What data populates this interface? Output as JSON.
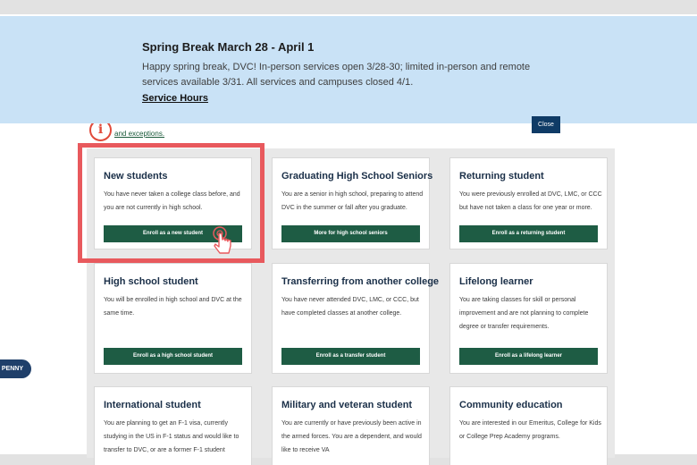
{
  "banner": {
    "title": "Spring Break March 28 - April 1",
    "text": "Happy spring break, DVC! In-person services open 3/28-30; limited in-person and remote services available 3/31. All services and campuses closed 4/1.",
    "link_label": "Service Hours",
    "close_label": "Close"
  },
  "notice": {
    "icon": "info-icon",
    "link_label": "and exceptions."
  },
  "cards": [
    {
      "title": "New students",
      "desc": "You have never taken a college class before, and you are not currently in high school.",
      "button": "Enroll as a new student"
    },
    {
      "title": "Graduating High School Seniors",
      "desc": "You are a senior in high school, preparing to attend DVC in the summer or fall after you graduate.",
      "button": "More for high school seniors"
    },
    {
      "title": "Returning student",
      "desc": "You were previously enrolled at DVC, LMC, or CCC but have not taken a class for one year or more.",
      "button": "Enroll as a returning student"
    },
    {
      "title": "High school student",
      "desc": "You will be enrolled in high school and DVC at the same time.",
      "button": "Enroll as a high school student"
    },
    {
      "title": "Transferring from another college",
      "desc": "You have never attended DVC, LMC, or CCC, but have completed classes at another college.",
      "button": "Enroll as a transfer student"
    },
    {
      "title": "Lifelong learner",
      "desc": "You are taking classes for skill or personal improvement and are not planning to complete degree or transfer requirements.",
      "button": "Enroll as a lifelong learner"
    },
    {
      "title": "International student",
      "desc": "You are planning to get an F-1 visa, currently studying in the US in F-1 status and would like to transfer to DVC, or are a former F-1 student"
    },
    {
      "title": "Military and veteran student",
      "desc": "You are currently or have previously been active in the armed forces. You are a dependent, and would like to receive VA"
    },
    {
      "title": "Community education",
      "desc": "You are interested in our Emeritus, College for Kids or College Prep Academy programs."
    }
  ],
  "chat": {
    "label": "PENNY"
  },
  "colors": {
    "banner_bg": "#c9e2f6",
    "close_button": "#0f3b66",
    "card_button": "#1e5c44",
    "highlight": "#e8595d",
    "card_title": "#1a2f48"
  }
}
